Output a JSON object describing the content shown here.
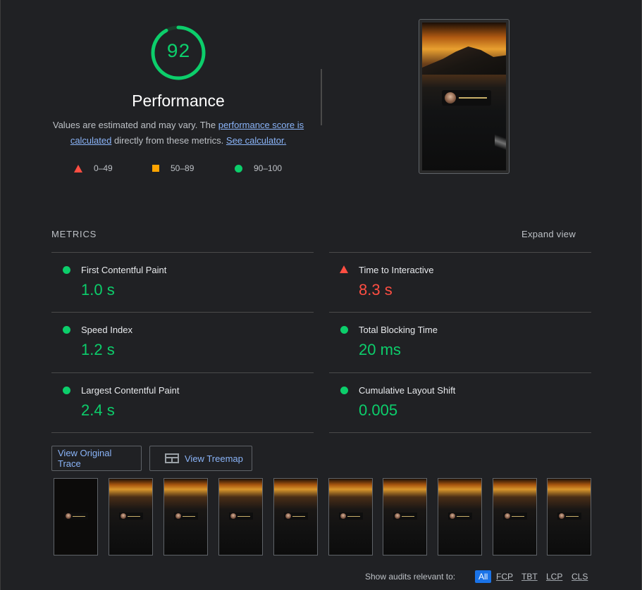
{
  "score": {
    "value": "92",
    "fraction": 0.92,
    "title": "Performance"
  },
  "description": {
    "text1": "Values are estimated and may vary. The ",
    "link1": "performance score is calculated",
    "text2": " directly from these metrics. ",
    "link2": "See calculator."
  },
  "legend": {
    "fail": "0–49",
    "average": "50–89",
    "pass": "90–100"
  },
  "metrics_section": {
    "title": "METRICS",
    "expand": "Expand view"
  },
  "metrics": {
    "fcp": {
      "name": "First Contentful Paint",
      "value": "1.0 s",
      "status": "pass"
    },
    "tti": {
      "name": "Time to Interactive",
      "value": "8.3 s",
      "status": "fail"
    },
    "si": {
      "name": "Speed Index",
      "value": "1.2 s",
      "status": "pass"
    },
    "tbt": {
      "name": "Total Blocking Time",
      "value": "20 ms",
      "status": "pass"
    },
    "lcp": {
      "name": "Largest Contentful Paint",
      "value": "2.4 s",
      "status": "pass"
    },
    "cls": {
      "name": "Cumulative Layout Shift",
      "value": "0.005",
      "status": "pass"
    }
  },
  "buttons": {
    "trace": "View Original Trace",
    "treemap": "View Treemap"
  },
  "audits": {
    "label": "Show audits relevant to:",
    "filters": [
      "All",
      "FCP",
      "TBT",
      "LCP",
      "CLS"
    ]
  },
  "colors": {
    "pass": "#0cce6b",
    "average": "#ffa400",
    "fail": "#ff4e42",
    "link": "#8ab4f8"
  }
}
